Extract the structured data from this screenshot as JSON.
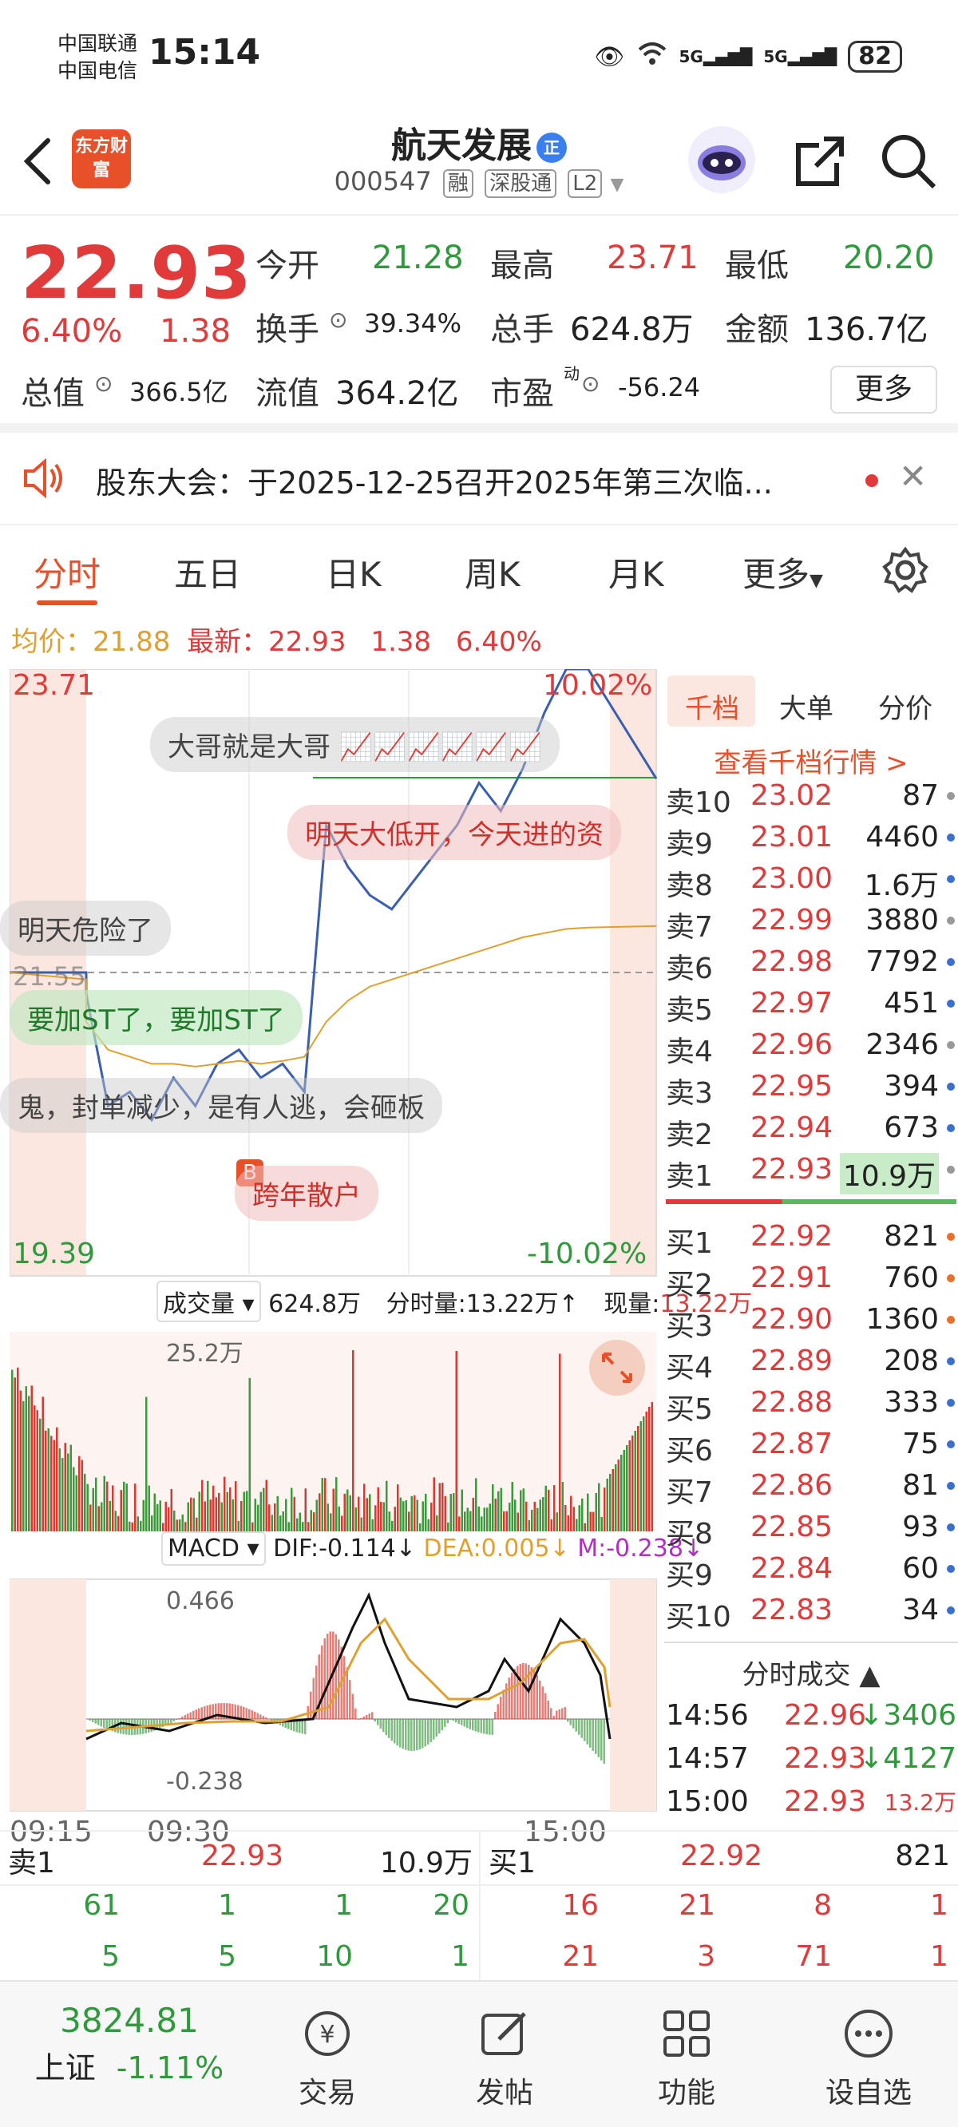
{
  "status": {
    "carrier1": "中国联通",
    "carrier2": "中国电信",
    "time": "15:14",
    "battery": "82",
    "signal1": "5G",
    "signal2": "5G"
  },
  "header": {
    "logo": "东方财富",
    "title": "航天发展",
    "title_badge": "正",
    "code": "000547",
    "tag_rong": "融",
    "tag_sgt": "深股通",
    "tag_l2": "L2"
  },
  "quote": {
    "price": "22.93",
    "change_pct": "6.40%",
    "change_abs": "1.38",
    "open_label": "今开",
    "open": "21.28",
    "high_label": "最高",
    "high": "23.71",
    "low_label": "最低",
    "low": "20.20",
    "turnover_label": "换手",
    "turnover": "39.34%",
    "volume_label": "总手",
    "volume": "624.8万",
    "amount_label": "金额",
    "amount": "136.7亿",
    "mcap_label": "总值",
    "mcap": "366.5亿",
    "float_label": "流值",
    "float": "364.2亿",
    "pe_label": "市盈",
    "pe_sup": "动",
    "pe": "-56.24",
    "more": "更多"
  },
  "notice": {
    "text": "股东大会：于2025-12-25召开2025年第三次临..."
  },
  "tabs": [
    "分时",
    "五日",
    "日K",
    "周K",
    "月K",
    "更多"
  ],
  "avg_line": {
    "avg_label": "均价：",
    "avg": "21.88",
    "last_label": "最新：",
    "last": "22.93",
    "chg": "1.38",
    "pct": "6.40%"
  },
  "chart": {
    "y_top": "23.71",
    "y_bottom": "19.39",
    "pct_top": "10.02%",
    "pct_bottom": "-10.02%",
    "prev_close": "21.55",
    "vol_title": "成交量",
    "vol_total": "624.8万",
    "vol_min_label": "分时量:13.22万",
    "vol_now_label": "现量:",
    "vol_now": "13.22万",
    "vol_max": "25.2万",
    "macd_title": "MACD",
    "dif": "DIF:-0.114",
    "dea": "DEA:0.005",
    "m": "M:-0.238",
    "macd_max": "0.466",
    "macd_min": "-0.238",
    "time_start": "09:15",
    "time_open": "09:30",
    "time_end": "15:00",
    "b_marker": "B",
    "b_label": "跨年散户",
    "comments": [
      "大哥就是大哥",
      "明天大低开，今天进的资",
      "明天危险了",
      "要加ST了，要加ST了",
      "鬼，封单减少，是有人逃，会砸板"
    ]
  },
  "chart_data": {
    "type": "line",
    "title": "",
    "xlabel": "",
    "ylabel": "",
    "ylim": [
      19.39,
      23.71
    ],
    "x_ticks": [
      "09:15",
      "09:30",
      "15:00"
    ],
    "series": [
      {
        "name": "",
        "values": [
          21.55,
          21.55,
          21.4,
          20.6,
          20.7,
          20.5,
          20.8,
          20.6,
          20.9,
          21.0,
          20.8,
          20.9,
          20.7,
          22.6,
          22.3,
          22.1,
          22.0,
          22.2,
          22.4,
          22.6,
          22.9,
          22.7,
          23.0,
          23.4,
          23.71,
          23.71,
          22.93
        ]
      },
      {
        "name": "",
        "values": [
          21.55,
          21.5,
          21.2,
          21.0,
          20.95,
          20.9,
          20.9,
          20.88,
          20.9,
          20.92,
          20.9,
          20.92,
          20.95,
          21.2,
          21.35,
          21.45,
          21.5,
          21.55,
          21.6,
          21.65,
          21.7,
          21.75,
          21.8,
          21.83,
          21.86,
          21.87,
          21.88
        ]
      }
    ]
  },
  "book": {
    "tabs": [
      "千档",
      "大单",
      "分价"
    ],
    "link": "查看千档行情 >",
    "asks": [
      {
        "label": "卖10",
        "price": "23.02",
        "vol": "87"
      },
      {
        "label": "卖9",
        "price": "23.01",
        "vol": "4460"
      },
      {
        "label": "卖8",
        "price": "23.00",
        "vol": "1.6万"
      },
      {
        "label": "卖7",
        "price": "22.99",
        "vol": "3880"
      },
      {
        "label": "卖6",
        "price": "22.98",
        "vol": "7792"
      },
      {
        "label": "卖5",
        "price": "22.97",
        "vol": "451"
      },
      {
        "label": "卖4",
        "price": "22.96",
        "vol": "2346"
      },
      {
        "label": "卖3",
        "price": "22.95",
        "vol": "394"
      },
      {
        "label": "卖2",
        "price": "22.94",
        "vol": "673"
      },
      {
        "label": "卖1",
        "price": "22.93",
        "vol": "10.9万"
      }
    ],
    "bids": [
      {
        "label": "买1",
        "price": "22.92",
        "vol": "821"
      },
      {
        "label": "买2",
        "price": "22.91",
        "vol": "760"
      },
      {
        "label": "买3",
        "price": "22.90",
        "vol": "1360"
      },
      {
        "label": "买4",
        "price": "22.89",
        "vol": "208"
      },
      {
        "label": "买5",
        "price": "22.88",
        "vol": "333"
      },
      {
        "label": "买6",
        "price": "22.87",
        "vol": "75"
      },
      {
        "label": "买7",
        "price": "22.86",
        "vol": "81"
      },
      {
        "label": "买8",
        "price": "22.85",
        "vol": "93"
      },
      {
        "label": "买9",
        "price": "22.84",
        "vol": "60"
      },
      {
        "label": "买10",
        "price": "22.83",
        "vol": "34"
      }
    ],
    "trades_title": "分时成交",
    "trades": [
      {
        "time": "14:56",
        "price": "22.96",
        "vol": "3406"
      },
      {
        "time": "14:57",
        "price": "22.93",
        "vol": "4127"
      },
      {
        "time": "15:00",
        "price": "22.93",
        "vol": "13.2万"
      }
    ]
  },
  "level1": {
    "ask_label": "卖1",
    "ask_price": "22.93",
    "ask_vol": "10.9万",
    "bid_label": "买1",
    "bid_price": "22.92",
    "bid_vol": "821",
    "ask_q1": [
      "61",
      "1",
      "1",
      "20"
    ],
    "ask_q2": [
      "5",
      "5",
      "10",
      "1"
    ],
    "bid_q1": [
      "16",
      "21",
      "8",
      "1"
    ],
    "bid_q2": [
      "21",
      "3",
      "71",
      "1"
    ]
  },
  "nav": {
    "index_value": "3824.81",
    "index_name": "上证",
    "index_chg": "-1.11%",
    "items": [
      "交易",
      "发帖",
      "功能",
      "设自选"
    ]
  }
}
